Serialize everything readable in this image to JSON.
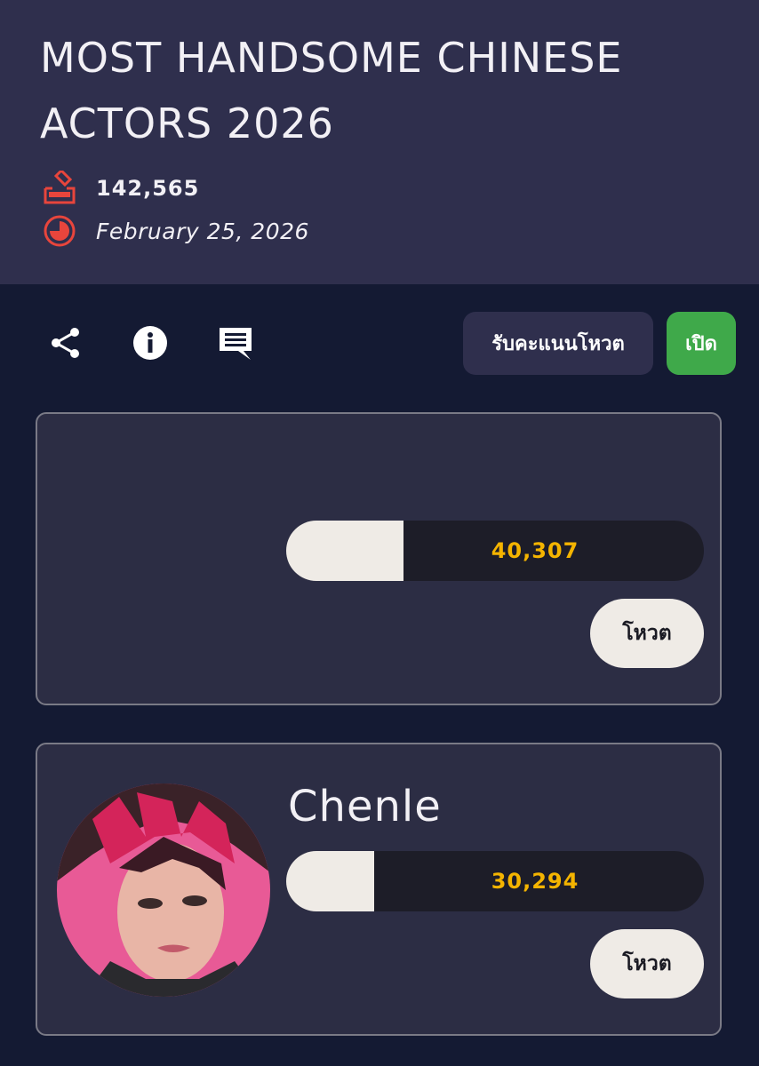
{
  "header": {
    "title": "MOST HANDSOME CHINESE ACTORS 2026",
    "votes": "142,565",
    "date": "February 25, 2026"
  },
  "toolbar": {
    "points_label": "รับคะแนนโหวต",
    "open_label": "เปิด"
  },
  "candidates": [
    {
      "name": "",
      "votes": "40,307",
      "share": 0.28,
      "vote_label": "โหวต"
    },
    {
      "name": "Chenle",
      "votes": "30,294",
      "share": 0.21,
      "vote_label": "โหวต"
    }
  ],
  "colors": {
    "header_bg": "#2f2f4d",
    "page_bg": "#141a33",
    "accent_red": "#e8453c",
    "vote_count": "#f4b400",
    "open_green": "#3fa94a"
  }
}
